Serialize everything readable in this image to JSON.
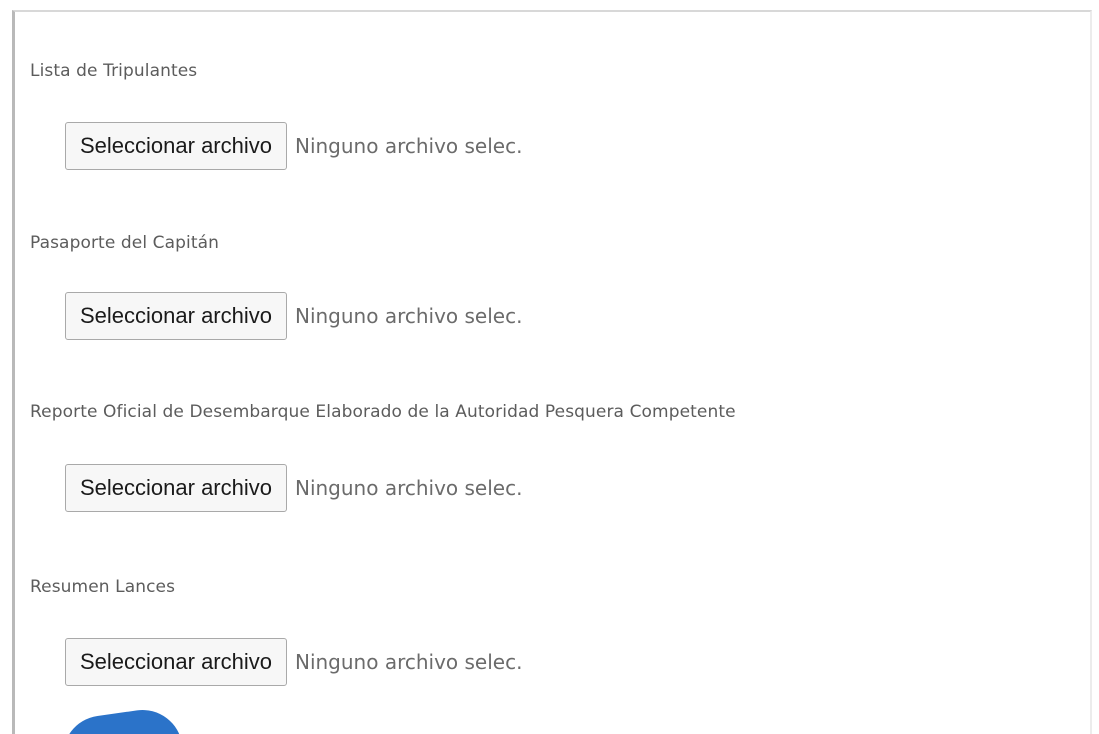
{
  "form": {
    "fields": [
      {
        "label": "Lista de Tripulantes",
        "button_label": "Seleccionar archivo",
        "status": "Ninguno archivo selec."
      },
      {
        "label": "Pasaporte del Capitán",
        "button_label": "Seleccionar archivo",
        "status": "Ninguno archivo selec."
      },
      {
        "label": "Reporte Oficial de Desembarque Elaborado de la Autoridad Pesquera Competente",
        "button_label": "Seleccionar archivo",
        "status": "Ninguno archivo selec."
      },
      {
        "label": "Resumen Lances",
        "button_label": "Seleccionar archivo",
        "status": "Ninguno archivo selec."
      }
    ]
  },
  "colors": {
    "label_text": "#5c5c5c",
    "button_border": "#a9a9a9",
    "button_bg": "#f7f7f7",
    "status_text": "#6b6b6b",
    "accent_blue": "#2b73c9"
  }
}
